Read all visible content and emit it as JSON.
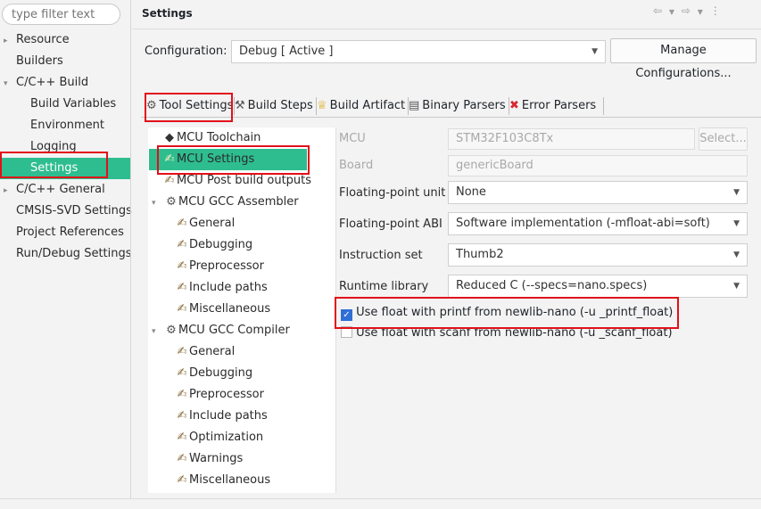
{
  "filter": {
    "placeholder": "type filter text"
  },
  "left_tree": [
    {
      "label": "Resource",
      "expander": "▸",
      "indent": 0
    },
    {
      "label": "Builders",
      "expander": "",
      "indent": 0
    },
    {
      "label": "C/C++ Build",
      "expander": "▾",
      "indent": 0
    },
    {
      "label": "Build Variables",
      "expander": "",
      "indent": 1
    },
    {
      "label": "Environment",
      "expander": "",
      "indent": 1
    },
    {
      "label": "Logging",
      "expander": "",
      "indent": 1
    },
    {
      "label": "Settings",
      "expander": "",
      "indent": 1,
      "selected": true
    },
    {
      "label": "C/C++ General",
      "expander": "▸",
      "indent": 0
    },
    {
      "label": "CMSIS-SVD Settings",
      "expander": "",
      "indent": 0
    },
    {
      "label": "Project References",
      "expander": "",
      "indent": 0
    },
    {
      "label": "Run/Debug Settings",
      "expander": "",
      "indent": 0
    }
  ],
  "header": {
    "title": "Settings"
  },
  "configuration": {
    "label": "Configuration:",
    "value": "Debug  [ Active ]",
    "manage_button": "Manage Configurations..."
  },
  "tabs": [
    {
      "label": "Tool Settings",
      "icon": "⚙",
      "icon_name": "gear-icon"
    },
    {
      "label": "Build Steps",
      "icon": "⚒",
      "icon_name": "hammer-icon"
    },
    {
      "label": "Build Artifact",
      "icon": "♕",
      "icon_name": "trophy-icon"
    },
    {
      "label": "Binary Parsers",
      "icon": "▤",
      "icon_name": "binary-icon"
    },
    {
      "label": "Error Parsers",
      "icon": "✖",
      "icon_name": "error-icon"
    }
  ],
  "tool_tree": [
    {
      "label": "MCU Toolchain",
      "expander": "",
      "icon": "◆",
      "indent": 0
    },
    {
      "label": "MCU Settings",
      "expander": "",
      "icon": "✍",
      "indent": 0,
      "selected": true
    },
    {
      "label": "MCU Post build outputs",
      "expander": "",
      "icon": "✍",
      "indent": 0
    },
    {
      "label": "MCU GCC Assembler",
      "expander": "▾",
      "icon": "⚙",
      "indent": 0
    },
    {
      "label": "General",
      "expander": "",
      "icon": "✍",
      "indent": 1
    },
    {
      "label": "Debugging",
      "expander": "",
      "icon": "✍",
      "indent": 1
    },
    {
      "label": "Preprocessor",
      "expander": "",
      "icon": "✍",
      "indent": 1
    },
    {
      "label": "Include paths",
      "expander": "",
      "icon": "✍",
      "indent": 1
    },
    {
      "label": "Miscellaneous",
      "expander": "",
      "icon": "✍",
      "indent": 1
    },
    {
      "label": "MCU GCC Compiler",
      "expander": "▾",
      "icon": "⚙",
      "indent": 0
    },
    {
      "label": "General",
      "expander": "",
      "icon": "✍",
      "indent": 1
    },
    {
      "label": "Debugging",
      "expander": "",
      "icon": "✍",
      "indent": 1
    },
    {
      "label": "Preprocessor",
      "expander": "",
      "icon": "✍",
      "indent": 1
    },
    {
      "label": "Include paths",
      "expander": "",
      "icon": "✍",
      "indent": 1
    },
    {
      "label": "Optimization",
      "expander": "",
      "icon": "✍",
      "indent": 1
    },
    {
      "label": "Warnings",
      "expander": "",
      "icon": "✍",
      "indent": 1
    },
    {
      "label": "Miscellaneous",
      "expander": "",
      "icon": "✍",
      "indent": 1
    }
  ],
  "mcu": {
    "label": "MCU",
    "value": "STM32F103C8Tx",
    "select_button": "Select..."
  },
  "board": {
    "label": "Board",
    "value": "genericBoard"
  },
  "fpu": {
    "label": "Floating-point unit",
    "value": "None"
  },
  "fabi": {
    "label": "Floating-point ABI",
    "value": "Software implementation (-mfloat-abi=soft)"
  },
  "iset": {
    "label": "Instruction set",
    "value": "Thumb2"
  },
  "runtime": {
    "label": "Runtime library",
    "value": "Reduced C (--specs=nano.specs)"
  },
  "printf_float": {
    "label": "Use float with printf from newlib-nano (-u _printf_float)",
    "checked": true
  },
  "scanf_float": {
    "label": "Use float with scanf from newlib-nano (-u _scanf_float)",
    "checked": false
  },
  "accent_color": "#2ebd8f",
  "highlight_color": "#e2101a"
}
